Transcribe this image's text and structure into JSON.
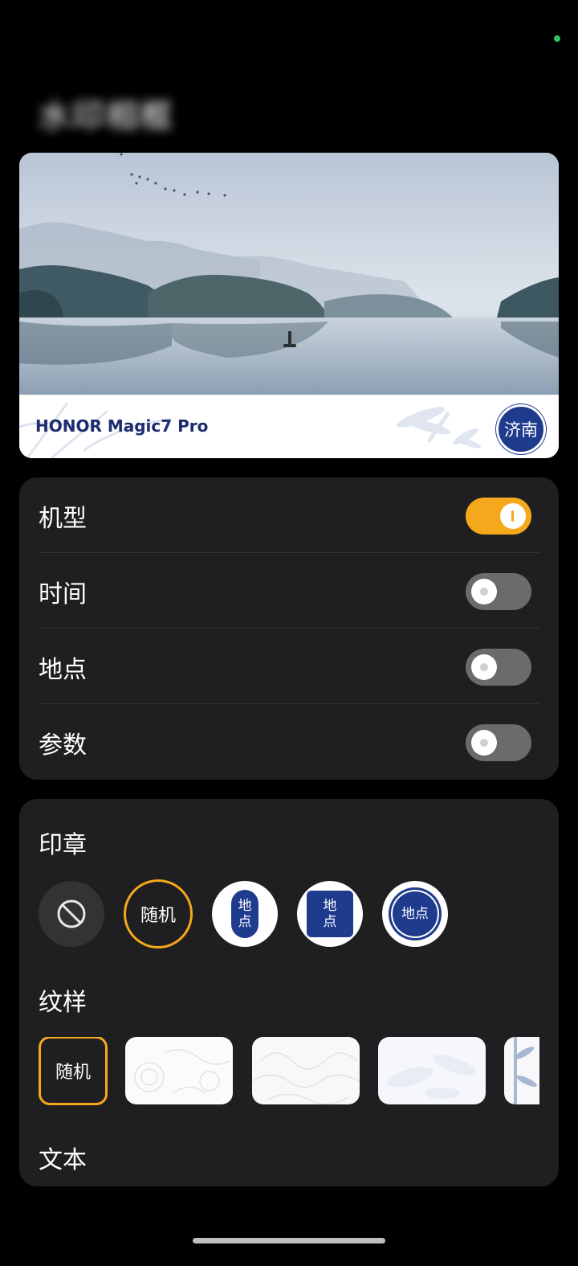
{
  "page": {
    "title": "水印相框"
  },
  "preview": {
    "model_text": "HONOR Magic7 Pro",
    "seal_text": "济南"
  },
  "toggles": [
    {
      "label": "机型",
      "on": true
    },
    {
      "label": "时间",
      "on": false
    },
    {
      "label": "地点",
      "on": false
    },
    {
      "label": "参数",
      "on": false
    }
  ],
  "seal_section": {
    "label": "印章",
    "options": [
      {
        "name": "none",
        "icon": "ban-icon"
      },
      {
        "name": "random",
        "label": "随机",
        "selected": true
      },
      {
        "name": "oval-seal",
        "text": "地点"
      },
      {
        "name": "square-seal",
        "text": "地点"
      },
      {
        "name": "round-seal",
        "text": "地点"
      }
    ]
  },
  "pattern_section": {
    "label": "纹样",
    "random_label": "随机"
  },
  "text_section": {
    "label": "文本"
  },
  "colors": {
    "accent": "#f5a81c",
    "card": "#1f1f21",
    "seal_blue": "#1f3b8d"
  }
}
